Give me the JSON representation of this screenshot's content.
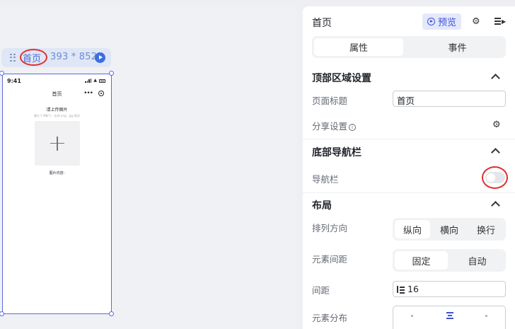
{
  "canvas": {
    "page_name": "首页",
    "page_size": "393 * 852",
    "phone": {
      "status_time": "9:41",
      "title": "首页",
      "upload_title": "请上传图片",
      "upload_hint": "最大 5 MB/个，支持 png、jpg 格式",
      "image_content_label": "图片内容:"
    }
  },
  "panel": {
    "title": "首页",
    "preview_label": "预览",
    "tabs": [
      {
        "label": "属性",
        "active": true
      },
      {
        "label": "事件",
        "active": false
      }
    ],
    "top_area": {
      "title": "顶部区域设置",
      "page_title_label": "页面标题",
      "page_title_value": "首页",
      "share_label": "分享设置"
    },
    "bottom_nav": {
      "title": "底部导航栏",
      "nav_label": "导航栏",
      "nav_enabled": false
    },
    "layout": {
      "title": "布局",
      "direction_label": "排列方向",
      "direction_options": [
        "纵向",
        "横向",
        "换行"
      ],
      "direction_selected": "纵向",
      "gap_label": "元素间距",
      "gap_options": [
        "固定",
        "自动"
      ],
      "gap_selected": "固定",
      "spacing_label": "间距",
      "spacing_value": "16",
      "distribution_label": "元素分布"
    }
  },
  "colors": {
    "accent": "#3f51d8",
    "annotation": "#e0302f",
    "page_bar": "#dfe6f5"
  }
}
